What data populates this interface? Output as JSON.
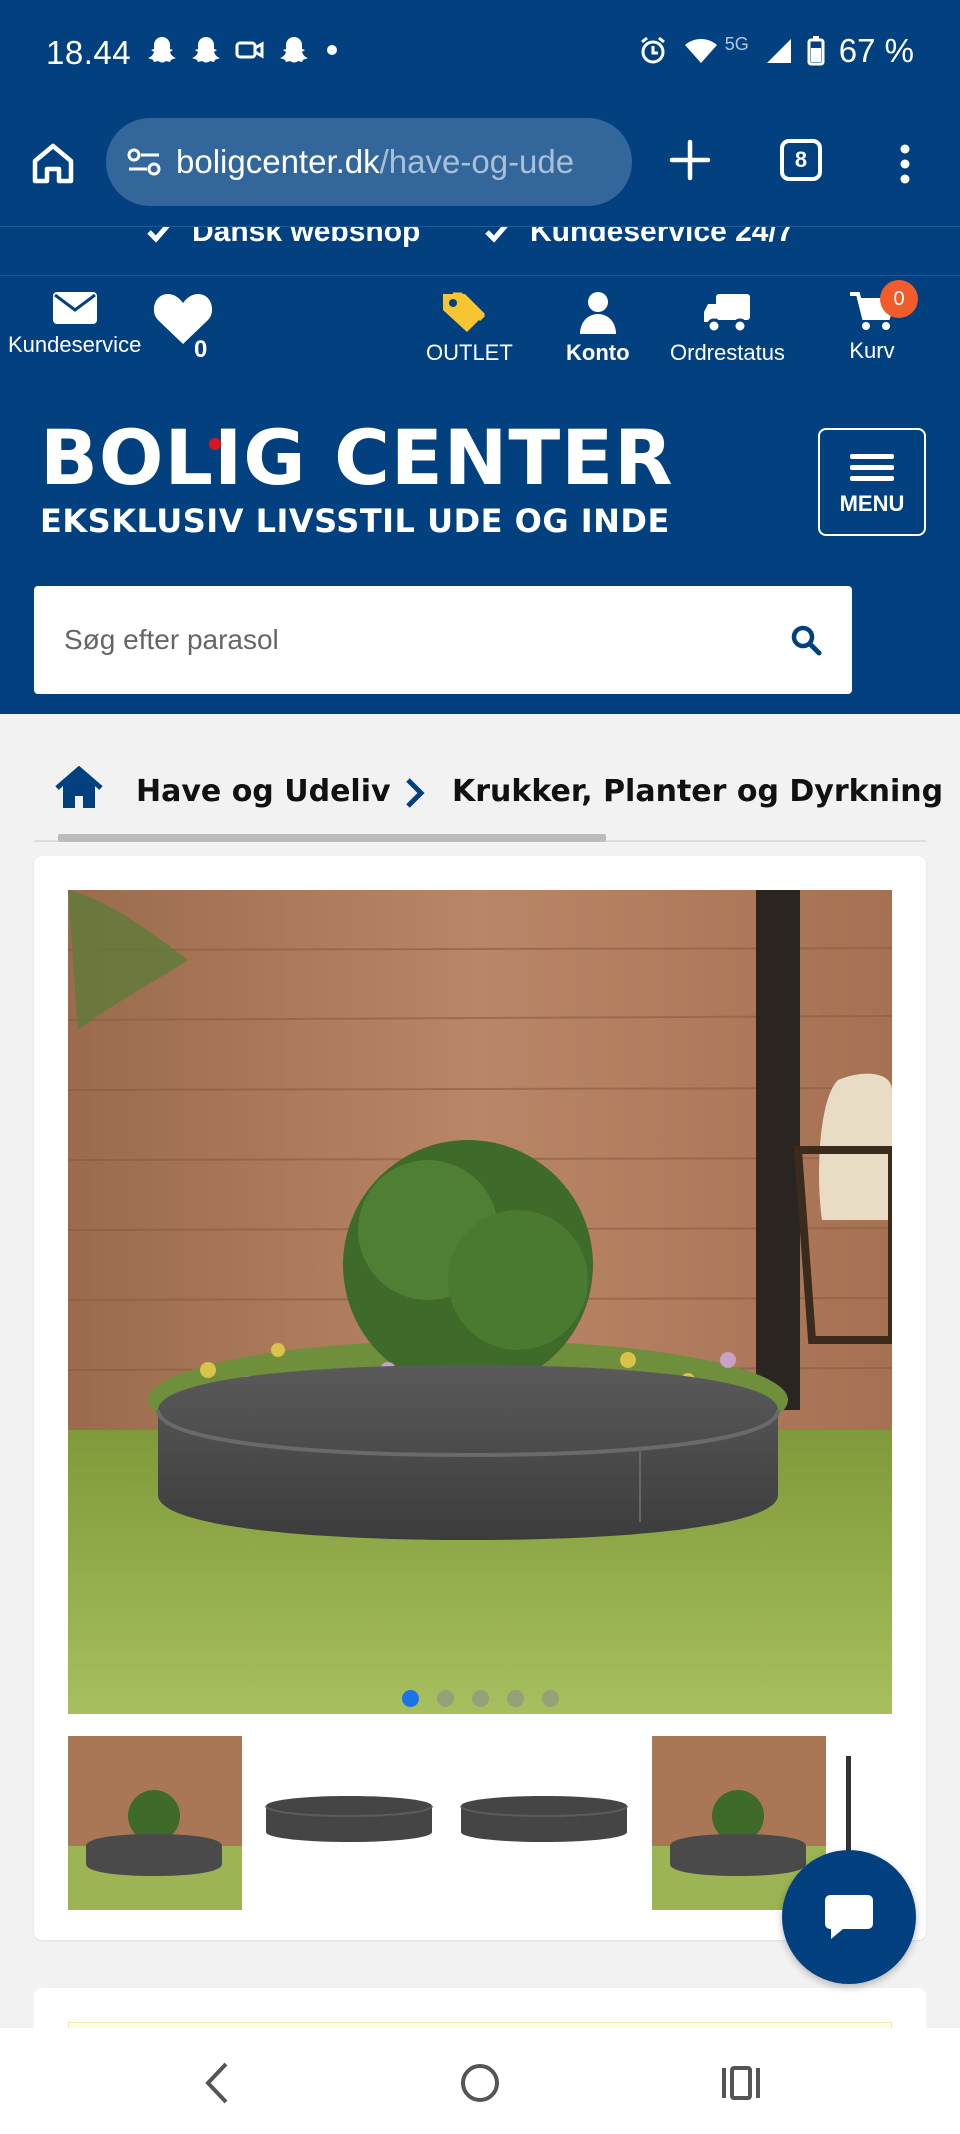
{
  "status_bar": {
    "time": "18.44",
    "network": "5G",
    "battery": "67 %"
  },
  "browser": {
    "url_host": "boligcenter.dk",
    "url_path": "/have-og-ude",
    "tab_count": "8"
  },
  "usp": {
    "items": [
      "Dansk webshop",
      "Kundeservice 24/7"
    ]
  },
  "topnav": {
    "customer_service": "Kundeservice",
    "wishlist_count": "0",
    "outlet": "OUTLET",
    "account": "Konto",
    "order_status": "Ordrestatus",
    "cart": "Kurv",
    "cart_count": "0"
  },
  "logo": {
    "main": "BOLIG CENTER",
    "tagline": "EKSKLUSIV LIVSSTIL UDE OG INDE"
  },
  "menu": {
    "label": "MENU"
  },
  "search": {
    "placeholder": "Søg efter parasol"
  },
  "breadcrumb": {
    "items": [
      "Have og Udeliv",
      "Krukker, Planter og Dyrkning"
    ]
  },
  "gallery": {
    "dot_count": 5,
    "active_index": 0
  },
  "colors": {
    "brand_blue": "#03407f",
    "cart_badge": "#f25c2a",
    "outlet_tag": "#f7c531",
    "active_dot": "#1a73e8"
  }
}
